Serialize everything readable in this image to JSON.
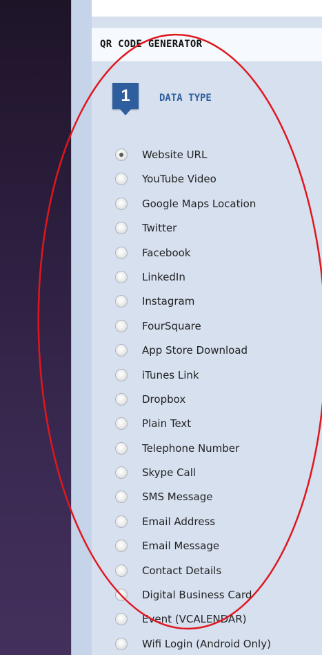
{
  "panel": {
    "title": "QR CODE GENERATOR"
  },
  "step": {
    "number": "1",
    "label": "DATA TYPE"
  },
  "data_types": [
    {
      "label": "Website URL",
      "selected": true
    },
    {
      "label": "YouTube Video",
      "selected": false
    },
    {
      "label": "Google Maps Location",
      "selected": false
    },
    {
      "label": "Twitter",
      "selected": false
    },
    {
      "label": "Facebook",
      "selected": false
    },
    {
      "label": "LinkedIn",
      "selected": false
    },
    {
      "label": "Instagram",
      "selected": false
    },
    {
      "label": "FourSquare",
      "selected": false
    },
    {
      "label": "App Store Download",
      "selected": false
    },
    {
      "label": "iTunes Link",
      "selected": false
    },
    {
      "label": "Dropbox",
      "selected": false
    },
    {
      "label": "Plain Text",
      "selected": false
    },
    {
      "label": "Telephone Number",
      "selected": false
    },
    {
      "label": "Skype Call",
      "selected": false
    },
    {
      "label": "SMS Message",
      "selected": false
    },
    {
      "label": "Email Address",
      "selected": false
    },
    {
      "label": "Email Message",
      "selected": false
    },
    {
      "label": "Contact Details",
      "selected": false
    },
    {
      "label": "Digital Business Card",
      "selected": false
    },
    {
      "label": "Event (VCALENDAR)",
      "selected": false
    },
    {
      "label": "Wifi Login (Android Only)",
      "selected": false
    }
  ],
  "colors": {
    "sidebar_dark": "#2c1e3e",
    "panel_background": "#d6e0ef",
    "step_badge": "#2f5e9e",
    "annotation_ellipse": "#e0161e"
  }
}
